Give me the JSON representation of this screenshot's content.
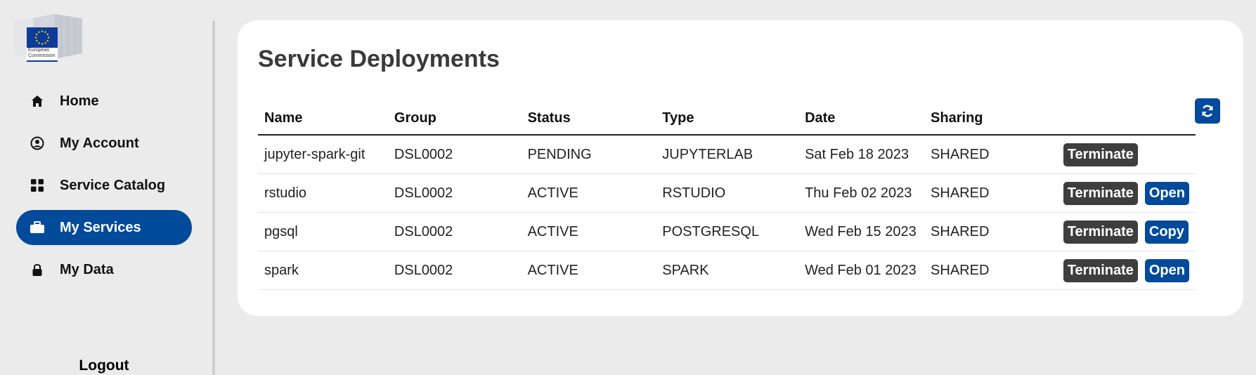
{
  "logo": {
    "line1": "European",
    "line2": "Commission"
  },
  "sidebar": {
    "items": [
      {
        "label": "Home",
        "icon": "home-icon"
      },
      {
        "label": "My Account",
        "icon": "user-circle-icon"
      },
      {
        "label": "Service Catalog",
        "icon": "grid-icon"
      },
      {
        "label": "My Services",
        "icon": "briefcase-icon",
        "active": true
      },
      {
        "label": "My Data",
        "icon": "lock-icon"
      }
    ],
    "logout": "Logout"
  },
  "main": {
    "title": "Service Deployments",
    "refresh_icon": "refresh-icon",
    "columns": [
      "Name",
      "Group",
      "Status",
      "Type",
      "Date",
      "Sharing"
    ],
    "rows": [
      {
        "name": "jupyter-spark-git",
        "group": "DSL0002",
        "status": "PENDING",
        "type": "JUPYTERLAB",
        "date": "Sat Feb 18 2023",
        "sharing": "SHARED",
        "terminate": "Terminate",
        "action": ""
      },
      {
        "name": "rstudio",
        "group": "DSL0002",
        "status": "ACTIVE",
        "type": "RSTUDIO",
        "date": "Thu Feb 02 2023",
        "sharing": "SHARED",
        "terminate": "Terminate",
        "action": "Open"
      },
      {
        "name": "pgsql",
        "group": "DSL0002",
        "status": "ACTIVE",
        "type": "POSTGRESQL",
        "date": "Wed Feb 15 2023",
        "sharing": "SHARED",
        "terminate": "Terminate",
        "action": "Copy"
      },
      {
        "name": "spark",
        "group": "DSL0002",
        "status": "ACTIVE",
        "type": "SPARK",
        "date": "Wed Feb 01 2023",
        "sharing": "SHARED",
        "terminate": "Terminate",
        "action": "Open"
      }
    ]
  },
  "colors": {
    "accent": "#024a9a",
    "terminate": "#3e3e3e",
    "background": "#ebebeb"
  }
}
